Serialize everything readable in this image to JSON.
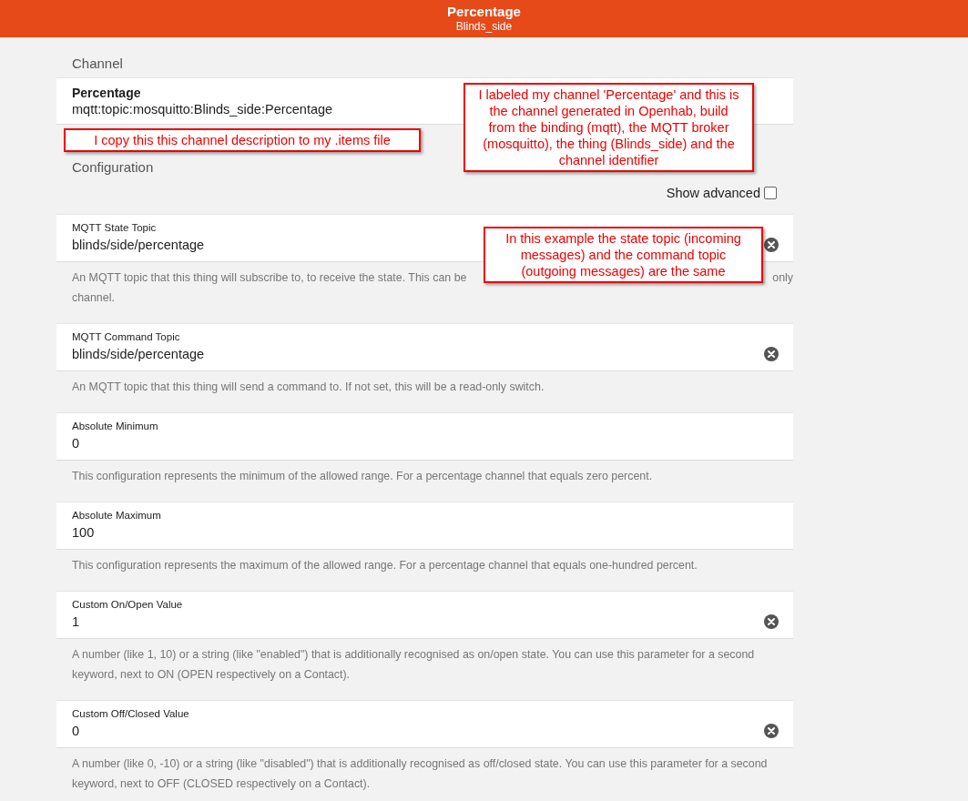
{
  "header": {
    "title": "Percentage",
    "subtitle": "Blinds_side"
  },
  "channel": {
    "heading": "Channel",
    "label": "Percentage",
    "uid": "mqtt:topic:mosquitto:Blinds_side:Percentage"
  },
  "configuration": {
    "heading": "Configuration",
    "show_advanced": {
      "label": "Show advanced",
      "checked": false
    }
  },
  "fields": [
    {
      "label": "MQTT State Topic",
      "value": "blinds/side/percentage",
      "clearable": true,
      "description": "An MQTT topic that this thing will subscribe to, to receive the state. This can be",
      "description_end": "only",
      "description_line_2": "channel."
    },
    {
      "label": "MQTT Command Topic",
      "value": "blinds/side/percentage",
      "clearable": true,
      "description": "An MQTT topic that this thing will send a command to. If not set, this will be a read-only switch."
    },
    {
      "label": "Absolute Minimum",
      "value": "0",
      "clearable": false,
      "description": "This configuration represents the minimum of the allowed range. For a percentage channel that equals zero percent."
    },
    {
      "label": "Absolute Maximum",
      "value": "100",
      "clearable": false,
      "description": "This configuration represents the maximum of the allowed range. For a percentage channel that equals one-hundred percent."
    },
    {
      "label": "Custom On/Open Value",
      "value": "1",
      "clearable": true,
      "description": "A number (like 1, 10) or a string (like \"enabled\") that is additionally recognised as on/open state. You can use this parameter for a second keyword, next to ON (OPEN respectively on a Contact)."
    },
    {
      "label": "Custom Off/Closed Value",
      "value": "0",
      "clearable": true,
      "description": "A number (like 0, -10) or a string (like \"disabled\") that is additionally recognised as off/closed state. You can use this parameter for a second keyword, next to OFF (CLOSED respectively on a Contact)."
    }
  ],
  "annotations": [
    {
      "text": "I labeled my channel 'Percentage' and this is the channel generated in Openhab, build from the binding (mqtt), the MQTT broker (mosquitto), the thing (Blinds_side) and the channel identifier"
    },
    {
      "text": "I copy this this channel description to my .items file"
    },
    {
      "text": "In this example the state topic (incoming messages) and the command topic (outgoing messages) are the same"
    }
  ]
}
